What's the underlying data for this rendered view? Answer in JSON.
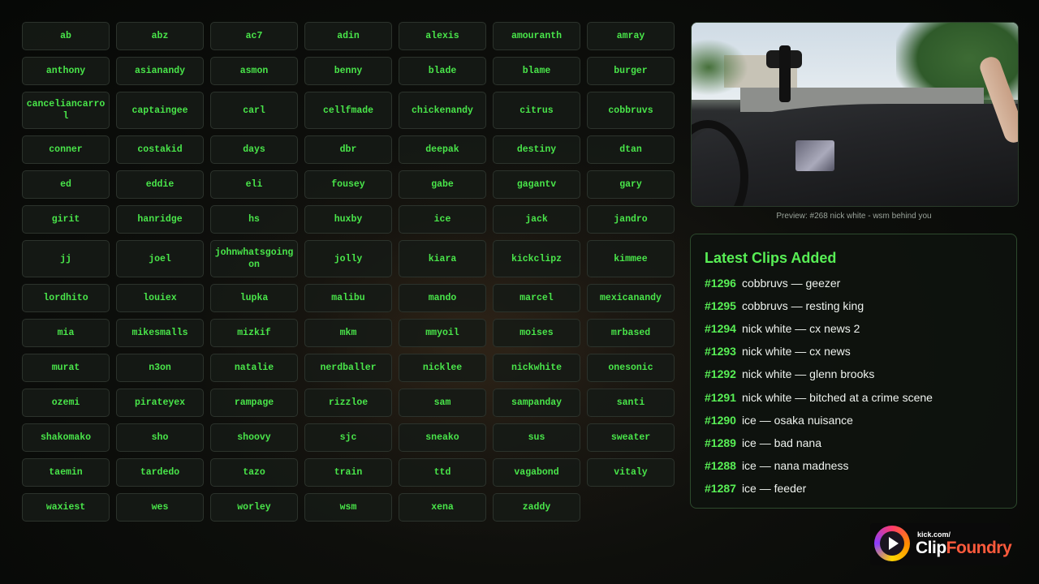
{
  "streamers": [
    "ab",
    "abz",
    "ac7",
    "adin",
    "alexis",
    "amouranth",
    "amray",
    "anthony",
    "asianandy",
    "asmon",
    "benny",
    "blade",
    "blame",
    "burger",
    "canceliancarrol",
    "captaingee",
    "carl",
    "cellfmade",
    "chickenandy",
    "citrus",
    "cobbruvs",
    "conner",
    "costakid",
    "days",
    "dbr",
    "deepak",
    "destiny",
    "dtan",
    "ed",
    "eddie",
    "eli",
    "fousey",
    "gabe",
    "gagantv",
    "gary",
    "girit",
    "hanridge",
    "hs",
    "huxby",
    "ice",
    "jack",
    "jandro",
    "jj",
    "joel",
    "johnwhatsgoingon",
    "jolly",
    "kiara",
    "kickclipz",
    "kimmee",
    "lordhito",
    "louiex",
    "lupka",
    "malibu",
    "mando",
    "marcel",
    "mexicanandy",
    "mia",
    "mikesmalls",
    "mizkif",
    "mkm",
    "mmyoil",
    "moises",
    "mrbased",
    "murat",
    "n3on",
    "natalie",
    "nerdballer",
    "nicklee",
    "nickwhite",
    "onesonic",
    "ozemi",
    "pirateyex",
    "rampage",
    "rizzloe",
    "sam",
    "sampanday",
    "santi",
    "shakomako",
    "sho",
    "shoovy",
    "sjc",
    "sneako",
    "sus",
    "sweater",
    "taemin",
    "tardedo",
    "tazo",
    "train",
    "ttd",
    "vagabond",
    "vitaly",
    "waxiest",
    "wes",
    "worley",
    "wsm",
    "xena",
    "zaddy"
  ],
  "preview": {
    "caption": "Preview: #268 nick white - wsm behind you"
  },
  "clips": {
    "title": "Latest Clips Added",
    "items": [
      {
        "num": "#1296",
        "text": "cobbruvs — geezer"
      },
      {
        "num": "#1295",
        "text": "cobbruvs — resting king"
      },
      {
        "num": "#1294",
        "text": "nick white — cx news 2"
      },
      {
        "num": "#1293",
        "text": "nick white — cx news"
      },
      {
        "num": "#1292",
        "text": "nick white — glenn brooks"
      },
      {
        "num": "#1291",
        "text": "nick white — bitched at a crime scene"
      },
      {
        "num": "#1290",
        "text": "ice — osaka nuisance"
      },
      {
        "num": "#1289",
        "text": "ice — bad nana"
      },
      {
        "num": "#1288",
        "text": "ice — nana madness"
      },
      {
        "num": "#1287",
        "text": "ice — feeder"
      }
    ]
  },
  "logo": {
    "small": "kick.com/",
    "clip": "Clip",
    "foundry": "Foundry"
  },
  "colors": {
    "accent_green": "#49e64a",
    "logo_accent": "#ff5a3c"
  }
}
